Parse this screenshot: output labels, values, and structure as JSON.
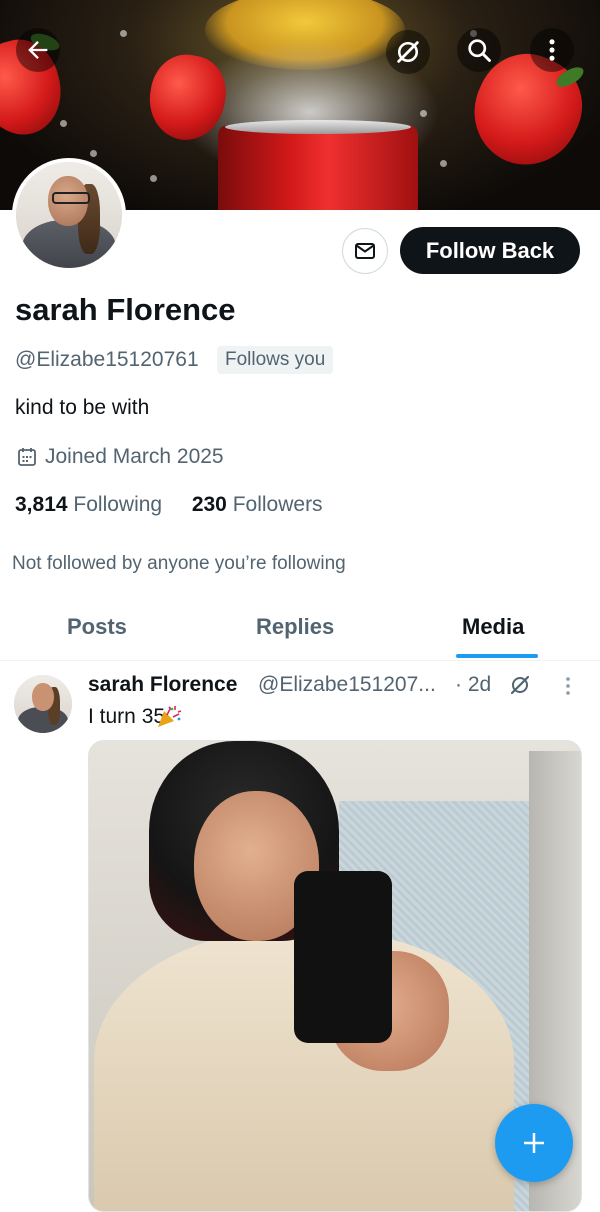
{
  "profile": {
    "display_name": "sarah Florence",
    "handle": "@Elizabe15120761",
    "follows_you_badge": "Follows you",
    "bio": "kind to be with",
    "joined": "Joined March 2025",
    "following_count": "3,814",
    "following_label": "Following",
    "followers_count": "230",
    "followers_label": "Followers",
    "mutuals_note": "Not followed by anyone you’re following"
  },
  "actions": {
    "follow_back_label": "Follow Back"
  },
  "tabs": [
    {
      "label": "Posts"
    },
    {
      "label": "Replies"
    },
    {
      "label": "Media"
    }
  ],
  "active_tab": "Media",
  "post": {
    "author_name": "sarah Florence",
    "author_handle": "@Elizabe151207...",
    "time": "· 2d",
    "text": "I turn 35"
  },
  "icons": {
    "back": "arrow-left-icon",
    "grok": "grok-icon",
    "search": "search-icon",
    "more": "more-vertical-icon",
    "message": "envelope-icon",
    "calendar": "calendar-icon",
    "compose": "plus-icon"
  },
  "colors": {
    "accent": "#1d9bf0",
    "primary_button": "#0f1419",
    "secondary_text": "#536471"
  }
}
